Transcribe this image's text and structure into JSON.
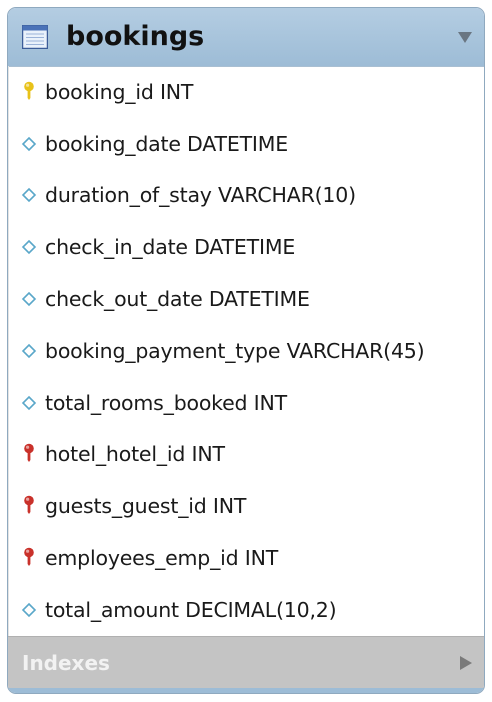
{
  "table": {
    "name": "bookings",
    "icon": "table-icon"
  },
  "columns": [
    {
      "text": "booking_id INT",
      "icon": "primary-key-icon",
      "color": "#e8c21a"
    },
    {
      "text": "booking_date DATETIME",
      "icon": "column-diamond-icon",
      "color": "#5aa7c9"
    },
    {
      "text": "duration_of_stay VARCHAR(10)",
      "icon": "column-diamond-icon",
      "color": "#5aa7c9"
    },
    {
      "text": "check_in_date DATETIME",
      "icon": "column-diamond-icon",
      "color": "#5aa7c9"
    },
    {
      "text": "check_out_date DATETIME",
      "icon": "column-diamond-icon",
      "color": "#5aa7c9"
    },
    {
      "text": "booking_payment_type VARCHAR(45)",
      "icon": "column-diamond-icon",
      "color": "#5aa7c9"
    },
    {
      "text": "total_rooms_booked INT",
      "icon": "column-diamond-icon",
      "color": "#5aa7c9"
    },
    {
      "text": "hotel_hotel_id INT",
      "icon": "foreign-key-icon",
      "color": "#c9312a"
    },
    {
      "text": "guests_guest_id INT",
      "icon": "foreign-key-icon",
      "color": "#c9312a"
    },
    {
      "text": "employees_emp_id INT",
      "icon": "foreign-key-icon",
      "color": "#c9312a"
    },
    {
      "text": "total_amount DECIMAL(10,2)",
      "icon": "column-diamond-icon",
      "color": "#5aa7c9"
    }
  ],
  "indexes": {
    "label": "Indexes",
    "icon": "expand-arrow-icon"
  },
  "colors": {
    "header": "#9dbcd6",
    "indexes_bar": "#c4c4c4"
  }
}
